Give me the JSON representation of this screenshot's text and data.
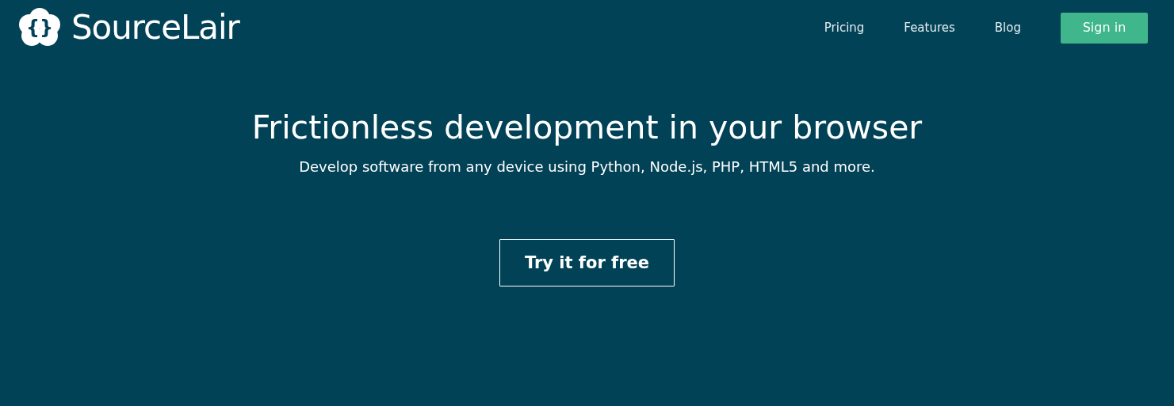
{
  "header": {
    "logo_text": "SourceLair",
    "logo_braces": "{}",
    "nav": [
      {
        "label": "Pricing"
      },
      {
        "label": "Features"
      },
      {
        "label": "Blog"
      }
    ],
    "sign_in": "Sign in"
  },
  "hero": {
    "title": "Frictionless development in your browser",
    "subtitle": "Develop software from any device using Python, Node.js, PHP, HTML5 and more.",
    "cta": "Try it for free"
  }
}
